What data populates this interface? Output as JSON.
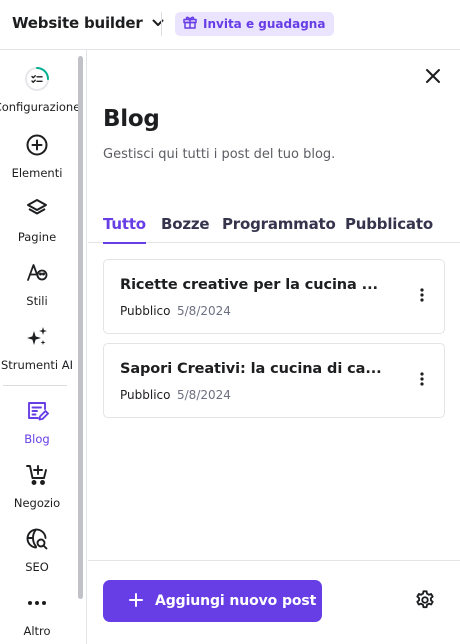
{
  "topbar": {
    "app_title": "Website builder",
    "invite_label": "Invita e guadagna"
  },
  "nav": {
    "items": [
      {
        "label": "Configurazione",
        "icon": "setup-progress-icon"
      },
      {
        "label": "Elementi",
        "icon": "plus-circle-icon"
      },
      {
        "label": "Pagine",
        "icon": "layers-icon"
      },
      {
        "label": "Stili",
        "icon": "styles-icon"
      },
      {
        "label": "Strumenti AI",
        "icon": "sparkles-icon"
      },
      {
        "label": "Blog",
        "icon": "blog-icon",
        "active": true
      },
      {
        "label": "Negozio",
        "icon": "cart-add-icon"
      },
      {
        "label": "SEO",
        "icon": "seo-icon"
      },
      {
        "label": "Altro",
        "icon": "more-horizontal-icon"
      }
    ]
  },
  "panel": {
    "title": "Blog",
    "subtitle": "Gestisci qui tutti i post del tuo blog.",
    "tabs": [
      {
        "label": "Tutto",
        "active": true
      },
      {
        "label": "Bozze"
      },
      {
        "label": "Programmato"
      },
      {
        "label": "Pubblicato"
      }
    ],
    "posts": [
      {
        "title": "Ricette creative per la cucina ...",
        "status": "Pubblico",
        "date": "5/8/2024"
      },
      {
        "title": "Sapori Creativi: la cucina di ca...",
        "status": "Pubblico",
        "date": "5/8/2024"
      }
    ],
    "add_button_label": "Aggiungi nuovo post"
  },
  "colors": {
    "accent": "#673de6",
    "accent_light": "#ebe4ff",
    "text": "#1d1e20",
    "muted": "#6d7081",
    "border": "#e3e4e8"
  }
}
